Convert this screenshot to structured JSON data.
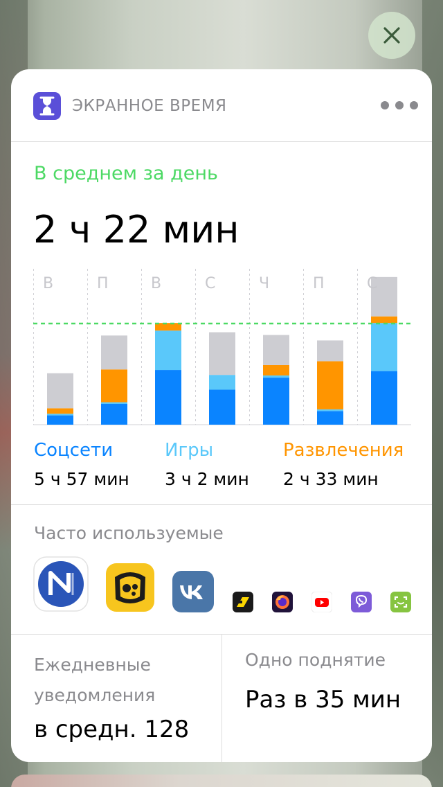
{
  "header": {
    "title": "ЭКРАННОЕ ВРЕМЯ"
  },
  "summary": {
    "avg_label": "В среднем за день",
    "avg_value": "2 ч 22 мин"
  },
  "chart_data": {
    "type": "bar",
    "stacked": true,
    "categories": [
      "В",
      "П",
      "В",
      "С",
      "Ч",
      "П",
      "С"
    ],
    "unit": "minutes (estimated)",
    "series": [
      {
        "name": "Соцсети",
        "color": "#0a84ff",
        "values": [
          17,
          38,
          100,
          64,
          86,
          25,
          98
        ]
      },
      {
        "name": "Игры",
        "color": "#5ac8fa",
        "values": [
          3,
          3,
          72,
          27,
          4,
          3,
          88
        ]
      },
      {
        "name": "Развлечения",
        "color": "#ff9500",
        "values": [
          10,
          60,
          14,
          0,
          19,
          88,
          12
        ]
      },
      {
        "name": "",
        "color": "#cdcdd2",
        "values": [
          64,
          62,
          0,
          78,
          55,
          38,
          72
        ]
      }
    ],
    "average_line": 185,
    "ylim": [
      0,
      285
    ],
    "average_line_color": "#4cd964"
  },
  "legend": [
    {
      "name": "Соцсети",
      "value": "5 ч 57 мин",
      "color": "#0a84ff"
    },
    {
      "name": "Игры",
      "value": "3 ч 2 мин",
      "color": "#5ac8fa"
    },
    {
      "name": "Развлечения",
      "value": "2 ч 33 мин",
      "color": "#ff9500"
    }
  ],
  "frequent": {
    "title": "Часто используемые",
    "apps": [
      "news-app-icon",
      "brawl-stars-icon",
      "vk-icon",
      "yandex-taxi-icon",
      "firefox-icon",
      "youtube-icon",
      "viber-icon",
      "screen-app-icon"
    ]
  },
  "notifications": {
    "label": "Ежедневные уведомления",
    "value": "в средн. 128"
  },
  "pickups": {
    "label": "Одно поднятие",
    "value": "Раз в 35 мин"
  }
}
